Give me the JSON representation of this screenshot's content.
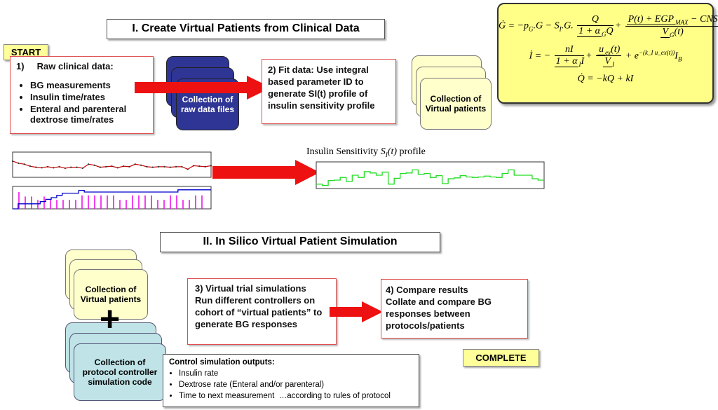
{
  "section1": {
    "title": "I. Create Virtual Patients from Clinical Data",
    "start_label": "START"
  },
  "step1": {
    "heading": "1)     Raw clinical data:",
    "items": [
      "BG measurements",
      "Insulin time/rates",
      "Enteral and parenteral dextrose time/rates"
    ]
  },
  "raw_files": {
    "label": "Collection of raw data files"
  },
  "step2": {
    "text": "2)    Fit data: Use integral based parameter ID to generate SI(t) profile of insulin sensitivity profile"
  },
  "virtual_patients_top": {
    "label": "Collection of Virtual patients"
  },
  "equations": {
    "g_lhs": "Ġ",
    "g_rhs1": "= −p",
    "g_rhs1_sub": "G",
    "g_rhs2": ".G − S",
    "g_rhs2_sub": "I",
    "g_rhs3": ".G.",
    "g_frac1_num": "Q",
    "g_frac1_den": "1 + α",
    "g_frac1_den_sub": "G",
    "g_frac1_den_tail": "Q",
    "g_frac2_num": "P(t) + EGP",
    "g_frac2_num_sub": "MAX",
    "g_frac2_num_tail": " − CNS",
    "g_frac2_den": "V",
    "g_frac2_den_sub": "G",
    "g_frac2_den_tail": "(t)",
    "i_lhs": "İ = −",
    "i_frac1_num": "nI",
    "i_frac1_den": "1 + α",
    "i_frac1_den_sub": "I",
    "i_frac1_den_tail": "I",
    "i_frac2_num": "u",
    "i_frac2_num_sub": "ex",
    "i_frac2_num_tail": "(t)",
    "i_frac2_den": "V",
    "i_frac2_den_sub": "I",
    "i_exp": "+ e",
    "i_exp_sup": "−(k_I u_ex(t))",
    "i_tail": "I",
    "i_tail_sub": "B",
    "q_eq": "Q̇ = −kQ + kI"
  },
  "plots": {
    "si_title_prefix": "Insulin Sensitivity ",
    "si_title_symbol": "S",
    "si_title_sub": "I",
    "si_title_arg": "(t)",
    "si_title_suffix": " profile",
    "bg_color": "#cc0000",
    "insulin_color": "#0000cc",
    "dextrose_color": "#ee00ee",
    "si_color": "#22dd22",
    "bg_values": [
      3.2,
      2.8,
      2.6,
      2.2,
      2.0,
      1.9,
      2.1,
      1.9,
      2.1,
      1.8,
      2.0,
      2.0,
      1.8,
      2.6,
      2.4,
      2.0,
      2.1,
      2.2,
      1.9,
      2.2,
      2.1,
      2.6,
      2.4,
      2.1,
      2.0,
      2.1,
      2.1,
      2.0,
      2.1,
      2.1,
      1.6,
      2.3,
      2.2,
      2.1,
      2.3
    ],
    "insulin_steps": [
      0,
      0.9,
      0.9,
      0.9,
      0.9,
      1.3,
      1.7,
      2.0,
      2.4,
      2.8,
      2.8,
      2.8,
      3.3,
      3.0,
      3.0,
      3.0,
      3.0,
      3.0,
      3.0,
      3.0,
      3.0,
      3.0,
      3.0,
      3.0,
      3.0,
      3.0,
      3.0,
      3.0,
      3.0,
      3.0,
      3.4,
      3.4,
      3.4,
      3.4,
      3.4,
      3.4
    ],
    "dextrose_bars": [
      3,
      2.2,
      2.2,
      1.6,
      2.2,
      1.6,
      1.6,
      1.6,
      1.6,
      1.6,
      2.4,
      2.4,
      2.4,
      2.4,
      2.4,
      2.4,
      1.6,
      1.6,
      2.4,
      2.4,
      2.4,
      2.4,
      1.6,
      1.6,
      2.4,
      2.4,
      1.6,
      1.6,
      2.4,
      2.4
    ],
    "si_values": [
      1,
      0.7,
      1.8,
      1.9,
      2.5,
      1.6,
      3,
      2.5,
      3.8,
      3.5,
      3,
      3.7,
      1,
      2.3,
      3.4,
      3.5,
      4.2,
      3.2,
      3.4,
      2.5,
      2.9,
      1.1,
      2.2,
      2.4,
      2.9,
      2.6,
      2.5,
      2.6,
      2.8,
      2.6,
      2.5,
      3.4,
      4.2,
      3,
      3,
      3,
      2.2,
      1.9
    ],
    "si_ylim": [
      0,
      6
    ]
  },
  "section2": {
    "title": "II. In Silico Virtual Patient Simulation"
  },
  "virtual_patients_bottom": {
    "label": "Collection of Virtual patients"
  },
  "plus": "+",
  "protocol_code": {
    "label": "Collection of protocol controller simulation code"
  },
  "step3": {
    "line1": "3) Virtual trial simulations",
    "line2": "Run different controllers on cohort of “virtual patients” to generate BG responses"
  },
  "step4": {
    "line1": "4) Compare results",
    "line2": "Collate and compare BG responses between protocols/patients"
  },
  "outputs": {
    "heading": "Control simulation outputs:",
    "items": [
      "Insulin rate",
      "Dextrose rate (Enteral and/or parenteral)",
      "Time to next measurement  …according to rules of protocol"
    ]
  },
  "complete_label": "COMPLETE",
  "colors": {
    "arrow": "#ee1111",
    "box_border": "#e05050",
    "yellow_label": "#ffff99",
    "equation_bg": "#ffff88",
    "navy": "#2f3594",
    "teal": "#bfe3e6",
    "cream": "#ffffcc"
  }
}
